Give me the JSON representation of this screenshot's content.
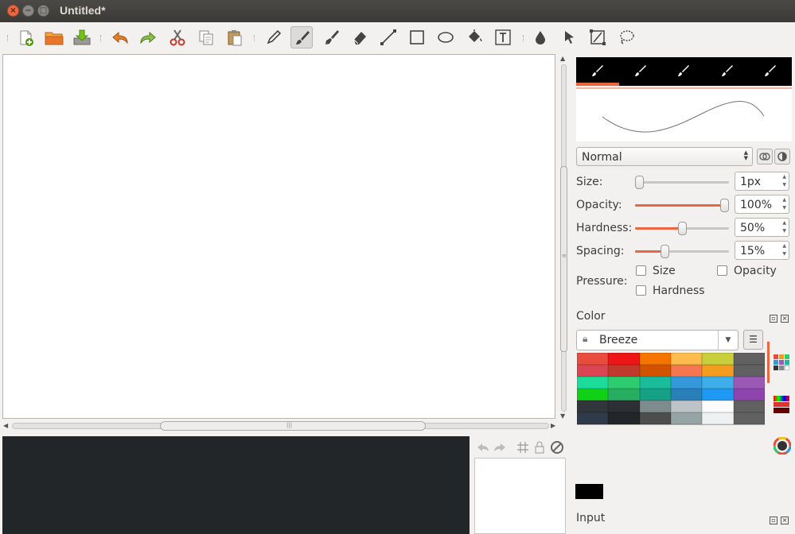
{
  "window": {
    "title": "Untitled*",
    "controls": [
      "×",
      "−",
      "□"
    ]
  },
  "toolbar": {
    "buttons": [
      {
        "name": "new-document-icon"
      },
      {
        "name": "open-folder-icon"
      },
      {
        "name": "save-icon"
      },
      {
        "name": "undo-icon"
      },
      {
        "name": "redo-icon"
      },
      {
        "name": "cut-icon"
      },
      {
        "name": "copy-icon"
      },
      {
        "name": "paste-icon"
      },
      {
        "name": "pencil-icon"
      },
      {
        "name": "brush-icon"
      },
      {
        "name": "calligraphy-pen-icon"
      },
      {
        "name": "eraser-icon"
      },
      {
        "name": "line-icon"
      },
      {
        "name": "rectangle-icon"
      },
      {
        "name": "ellipse-icon"
      },
      {
        "name": "fill-bucket-icon"
      },
      {
        "name": "text-tool-icon"
      },
      {
        "name": "color-picker-icon"
      },
      {
        "name": "pointer-icon"
      },
      {
        "name": "crop-icon"
      },
      {
        "name": "lasso-icon"
      }
    ],
    "active_tool": "brush-icon"
  },
  "brush": {
    "presets": [
      "brush-preset-icon",
      "brush-preset-icon",
      "brush-preset-icon",
      "brush-preset-icon",
      "brush-preset-icon"
    ],
    "selected_preset": 0,
    "blend_mode": "Normal",
    "size_label": "Size:",
    "size_value": "1px",
    "size_level": 0.0,
    "opacity_label": "Opacity:",
    "opacity_value": "100%",
    "opacity_level": 1.0,
    "hardness_label": "Hardness:",
    "hardness_value": "50%",
    "hardness_level": 0.5,
    "spacing_label": "Spacing:",
    "spacing_value": "15%",
    "spacing_level": 0.3,
    "pressure_label": "Pressure:",
    "pressure_size": "Size",
    "pressure_opacity": "Opacity",
    "pressure_hardness": "Hardness"
  },
  "color": {
    "title": "Color",
    "palette_name": "Breeze",
    "swatches": [
      "#e74c3c",
      "#ed1515",
      "#f67400",
      "#fdbc4b",
      "#c9ce3b",
      "#616161",
      "#da4453",
      "#c0392b",
      "#d35400",
      "#f47750",
      "#f39c1f",
      "#616161",
      "#1cdc9a",
      "#2ecc71",
      "#1abc9c",
      "#3498db",
      "#3daee9",
      "#9b59b6",
      "#11d116",
      "#27ae60",
      "#16a085",
      "#2980b9",
      "#1d99f3",
      "#8e44ad",
      "#31363b",
      "#2c2f33",
      "#7f8c8d",
      "#bdc3c7",
      "#fcfcfc",
      "#616161",
      "#2f3b4a",
      "#232629",
      "#4d4d4d",
      "#95a5a6",
      "#eff0f1",
      "#616161"
    ],
    "foreground": "#000000"
  },
  "input": {
    "title": "Input"
  },
  "colors": {
    "accent": "#e9663f",
    "dark_panel": "#232629"
  }
}
